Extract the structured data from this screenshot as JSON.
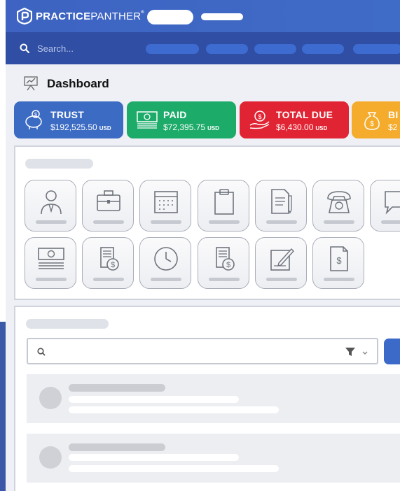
{
  "brand": {
    "name_bold": "PRACTICE",
    "name_thin": "PANTHER",
    "trademark": "®"
  },
  "search": {
    "placeholder": "Search..."
  },
  "page": {
    "title": "Dashboard"
  },
  "cards": [
    {
      "label": "TRUST",
      "amount": "$192,525.50",
      "currency": "USD",
      "color": "#3c6bc3",
      "icon": "piggy-bank-icon"
    },
    {
      "label": "PAID",
      "amount": "$72,395.75",
      "currency": "USD",
      "color": "#1dab6a",
      "icon": "cash-stack-icon"
    },
    {
      "label": "TOTAL DUE",
      "amount": "$6,430.00",
      "currency": "USD",
      "color": "#e12433",
      "icon": "hand-coin-icon"
    },
    {
      "label": "BI",
      "amount": "$2",
      "currency": "",
      "color": "#f5ab2b",
      "icon": "money-bag-icon"
    }
  ],
  "quick_tiles": [
    "contact-icon",
    "briefcase-icon",
    "calendar-icon",
    "clipboard-icon",
    "document-icon",
    "phone-icon",
    "message-icon",
    "cash-icon",
    "coins-invoice-icon",
    "clock-icon",
    "coins-invoice-icon",
    "note-edit-icon",
    "dollar-document-icon"
  ],
  "colors": {
    "topbar": "#3e63c2",
    "searchbar": "#2f4ea4",
    "nav_pill": "#3d6bd0",
    "panel_border": "#cfd3db"
  }
}
